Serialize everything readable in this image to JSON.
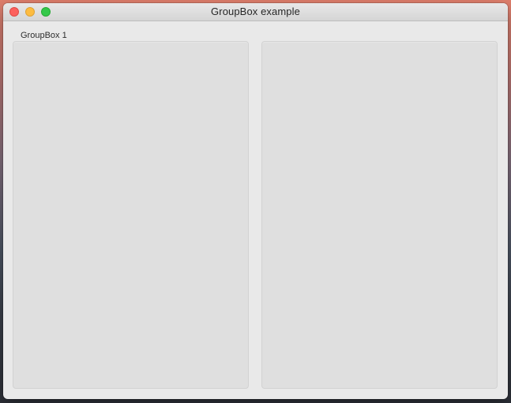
{
  "window": {
    "title": "GroupBox example"
  },
  "groupboxes": [
    {
      "title": "GroupBox 1"
    },
    {
      "title": ""
    }
  ]
}
